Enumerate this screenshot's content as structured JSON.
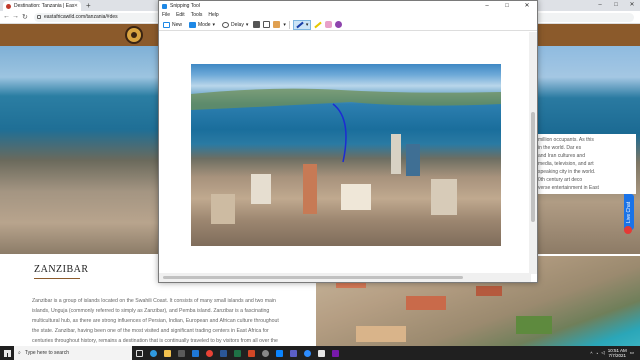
{
  "browser": {
    "tab_title": "Destination: Tanzania | East Afri...",
    "url": "eastafricawild.com/tanzania/#des"
  },
  "snip": {
    "title": "Snipping Tool",
    "menu": [
      "File",
      "Edit",
      "Tools",
      "Help"
    ],
    "new_label": "New",
    "mode_label": "Mode",
    "delay_label": "Delay"
  },
  "site": {
    "right_text": [
      "million occupants. As this",
      "in the world. Dar es",
      "and Iran cultures and",
      "media, television, and art",
      "speaking city in the world.",
      "0th century art deco",
      "verse entertainment in East"
    ],
    "heading": "ZANZIBAR",
    "paragraph": [
      "Zanzibar is a group of islands located on the Swahili Coast. It consists of many small islands and two main",
      "islands, Unguja (commonly referred to simply as Zanzibar), and Pemba island. Zanzibar is a fascinating",
      "multicultural hub, as there are strong influences of Persian, Indian, European and African culture throughout",
      "the state. Zanzibar, having been one of the most visited and significant trading centers in East Africa for",
      "centuries throughout history, remains a destination that is continually traveled to by visitors from all over the"
    ],
    "chat_label": "Live Chat"
  },
  "taskbar": {
    "search_placeholder": "Type here to search",
    "time": "10:51 AM",
    "date": "7/7/2021"
  },
  "colors": {
    "brown": "#8b5a2b",
    "chrome_tab": "#dee1e6",
    "accent_blue": "#1a73e8",
    "taskbar": "#202020"
  }
}
